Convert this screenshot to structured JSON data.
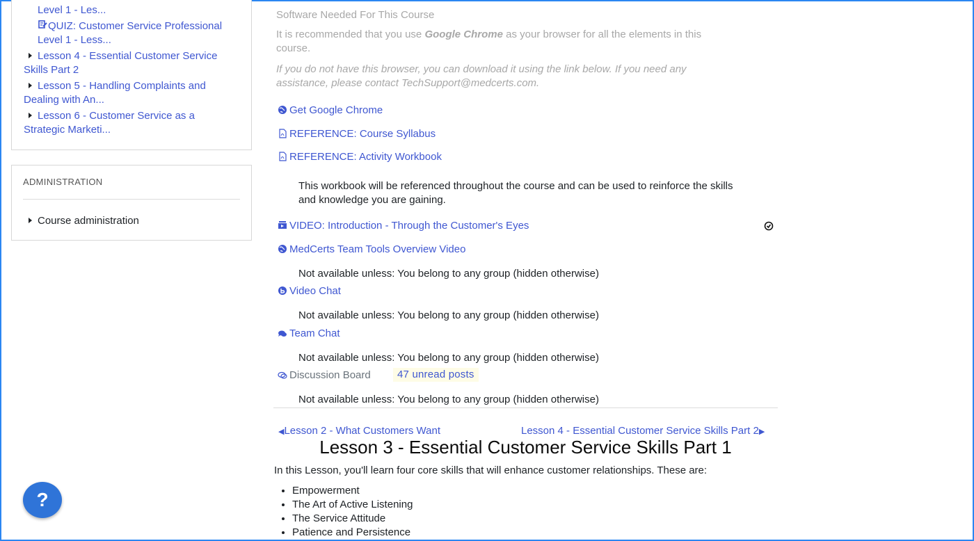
{
  "sidebar": {
    "items": [
      {
        "text": "Level 1 - Les..."
      },
      {
        "text": "QUIZ: Customer Service Professional"
      },
      {
        "text": "Level 1 - Less..."
      },
      {
        "text_line1": "Lesson 4 - Essential Customer Service",
        "text_line2": "Skills Part 2"
      },
      {
        "text_line1": "Lesson 5 - Handling Complaints and",
        "text_line2": "Dealing with An..."
      },
      {
        "text_line1": "Lesson 6 - Customer Service as a",
        "text_line2": "Strategic Marketi..."
      }
    ],
    "admin": {
      "heading": "ADMINISTRATION",
      "course_admin": "Course administration"
    }
  },
  "main": {
    "software_heading": "Software Needed For This Course",
    "rec_prefix": "It is recommended that you use ",
    "rec_bold": "Google Chrome",
    "rec_suffix_line1": " as your browser for all the elements in this",
    "rec_line2": "course.",
    "download_line1": "If you do not have this browser, you can download it using the link below. If you need any",
    "download_line2": "assistance, please contact TechSupport@medcerts.com.",
    "activities": {
      "chrome": "Get Google Chrome",
      "syllabus": "REFERENCE: Course Syllabus",
      "workbook": "REFERENCE: Activity Workbook",
      "workbook_desc_line1": "This workbook will be referenced throughout the course and can be used to reinforce the skills",
      "workbook_desc_line2": "and knowledge you are gaining.",
      "video_intro": "VIDEO: Introduction - Through the Customer's Eyes",
      "team_tools": "MedCerts Team Tools Overview Video",
      "video_chat": "Video Chat",
      "team_chat": "Team Chat",
      "discussion": "Discussion Board",
      "unread": "47 unread posts",
      "restriction": "Not available unless: You belong to any group (hidden otherwise)"
    },
    "nav": {
      "prev": "Lesson 2 - What Customers Want",
      "next": "Lesson 4 - Essential Customer Service Skills Part 2"
    },
    "lesson_title": "Lesson 3 - Essential Customer Service Skills Part 1",
    "lesson_intro": "In this Lesson, you'll learn four core skills that will enhance customer relationships. These are:",
    "skills": [
      "Empowerment",
      "The Art of Active Listening",
      "The Service Attitude",
      "Patience and Persistence"
    ]
  },
  "help_button": {
    "label": "?"
  },
  "colors": {
    "link": "#3f57d1",
    "frame": "#2b86f2",
    "help": "#2f74d8"
  }
}
